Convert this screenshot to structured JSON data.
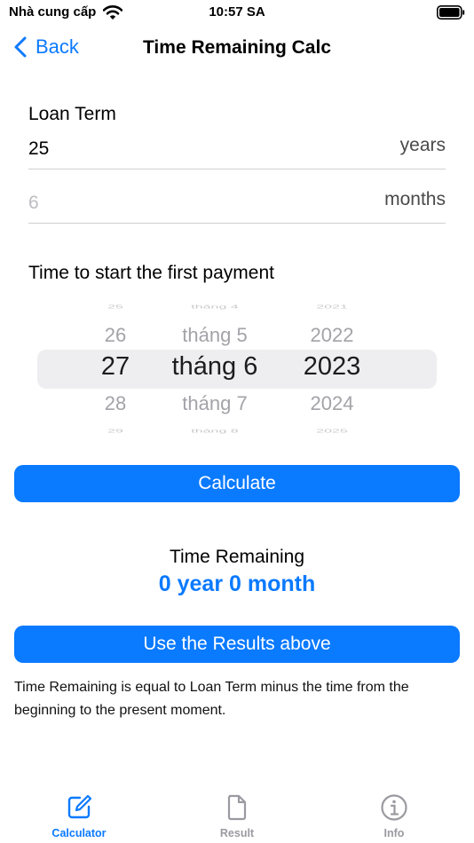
{
  "status_bar": {
    "carrier": "Nhà cung cấp",
    "time": "10:57 SA",
    "wifi_icon": "wifi-icon",
    "battery_icon": "battery-icon"
  },
  "nav": {
    "back_label": "Back",
    "title": "Time Remaining Calc"
  },
  "loan_term": {
    "label": "Loan Term",
    "years_value": "25",
    "years_unit": "years",
    "months_placeholder": "6",
    "months_unit": "months"
  },
  "first_payment": {
    "label": "Time to start the first payment",
    "picker": {
      "day": {
        "above": "26",
        "selected": "27",
        "below": "28"
      },
      "month": {
        "above": "tháng 5",
        "selected": "tháng 6",
        "below": "tháng 7"
      },
      "year": {
        "above": "2022",
        "selected": "2023",
        "below": "2024"
      }
    }
  },
  "calculate_label": "Calculate",
  "result": {
    "label": "Time Remaining",
    "value": "0 year 0 month"
  },
  "use_results_label": "Use the Results above",
  "description": "Time Remaining is equal to Loan Term minus the time from the beginning to the present moment.",
  "tabs": [
    {
      "label": "Calculator",
      "icon": "edit-icon",
      "active": true
    },
    {
      "label": "Result",
      "icon": "document-icon",
      "active": false
    },
    {
      "label": "Info",
      "icon": "info-icon",
      "active": false
    }
  ],
  "colors": {
    "accent": "#0a7aff",
    "inactive_tab": "#9a9aa0",
    "picker_highlight": "#eeeef0"
  }
}
